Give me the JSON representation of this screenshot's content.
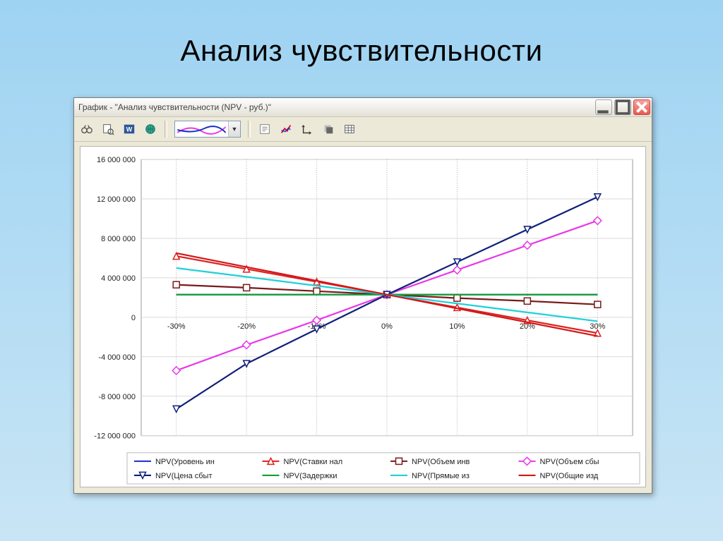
{
  "slide_title": "Анализ чувствительности",
  "window": {
    "title": "График - \"Анализ чувствительности (NPV - руб.)\"",
    "min_icon": "minimize-icon",
    "max_icon": "maximize-icon",
    "close_icon": "close-icon"
  },
  "toolbar": {
    "icons": [
      "binoculars-icon",
      "print-preview-icon",
      "word-icon",
      "globe-icon",
      "style-dropdown",
      "properties-icon",
      "trend-icon",
      "axes-icon",
      "shadow-icon",
      "grid-table-icon"
    ]
  },
  "chart_data": {
    "type": "line",
    "xlabel": "",
    "ylabel": "",
    "xlim": [
      -35,
      35
    ],
    "ylim": [
      -12000000,
      16000000
    ],
    "x_ticks": [
      "-30%",
      "-20%",
      "-10%",
      "0%",
      "10%",
      "20%",
      "30%"
    ],
    "y_ticks": [
      -12000000,
      -8000000,
      -4000000,
      0,
      4000000,
      8000000,
      12000000,
      16000000
    ],
    "x": [
      -30,
      -20,
      -10,
      0,
      10,
      20,
      30
    ],
    "series": [
      {
        "name": "NPV(Уровень ин",
        "color": "#1430c8",
        "marker": "none",
        "values": [
          2300000,
          2300000,
          2300000,
          2300000,
          2300000,
          2300000,
          2300000
        ]
      },
      {
        "name": "NPV(Ставки нал",
        "color": "#e02020",
        "marker": "triangle-open",
        "values": [
          6200000,
          4900000,
          3600000,
          2300000,
          1000000,
          -300000,
          -1600000
        ]
      },
      {
        "name": "NPV(Объем инв",
        "color": "#7a1a1a",
        "marker": "square-open",
        "values": [
          3300000,
          3000000,
          2650000,
          2300000,
          1950000,
          1650000,
          1300000
        ]
      },
      {
        "name": "NPV(Объем сбы",
        "color": "#e838e8",
        "marker": "diamond-open",
        "values": [
          -5400000,
          -2800000,
          -300000,
          2300000,
          4800000,
          7300000,
          9800000
        ]
      },
      {
        "name": "NPV(Цена сбыт",
        "color": "#10207a",
        "marker": "triangle-down-open",
        "values": [
          -9300000,
          -4700000,
          -1200000,
          2300000,
          5600000,
          8900000,
          12200000
        ]
      },
      {
        "name": "NPV(Задержки ",
        "color": "#10a030",
        "marker": "none",
        "values": [
          2300000,
          2300000,
          2300000,
          2300000,
          2300000,
          2300000,
          2300000
        ]
      },
      {
        "name": "NPV(Прямые из",
        "color": "#20d0d8",
        "marker": "none",
        "values": [
          5000000,
          4100000,
          3200000,
          2300000,
          1400000,
          500000,
          -400000
        ]
      },
      {
        "name": "NPV(Общие изд",
        "color": "#d01818",
        "marker": "none",
        "values": [
          6500000,
          5100000,
          3700000,
          2300000,
          900000,
          -500000,
          -1900000
        ]
      }
    ]
  },
  "legend_layout": {
    "cols": 4,
    "rows": 2
  }
}
